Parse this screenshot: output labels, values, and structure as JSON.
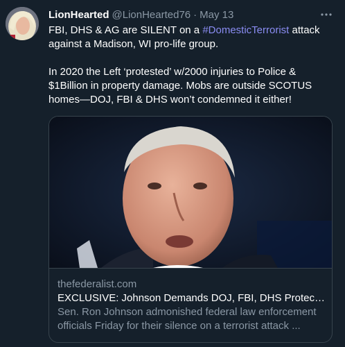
{
  "tweet": {
    "display_name": "LionHearted",
    "handle": "@LionHearted76",
    "separator": "·",
    "date": "May 13",
    "more_icon": "more-horizontal-icon",
    "text_part1": "FBI, DHS & AG are SILENT on a ",
    "hashtag": "#DomesticTerrorist",
    "text_part2": " attack against a Madison, WI pro-life group.",
    "paragraph2": "In 2020 the Left ‘protested’ w/2000 injuries to Police & $1Billion in property damage. Mobs are outside SCOTUS homes—DOJ, FBI & DHS won’t condemned it either!"
  },
  "card": {
    "domain": "thefederalist.com",
    "title": "EXCLUSIVE: Johnson Demands DOJ, FBI, DHS Protect ...",
    "description": "Sen. Ron Johnson admonished federal law enforcement officials Friday for their silence on a terrorist attack ..."
  },
  "colors": {
    "background": "#15202b",
    "text": "#ffffff",
    "secondary": "#8b98a5",
    "hashtag": "#8a8cf2",
    "border": "#38444d"
  }
}
